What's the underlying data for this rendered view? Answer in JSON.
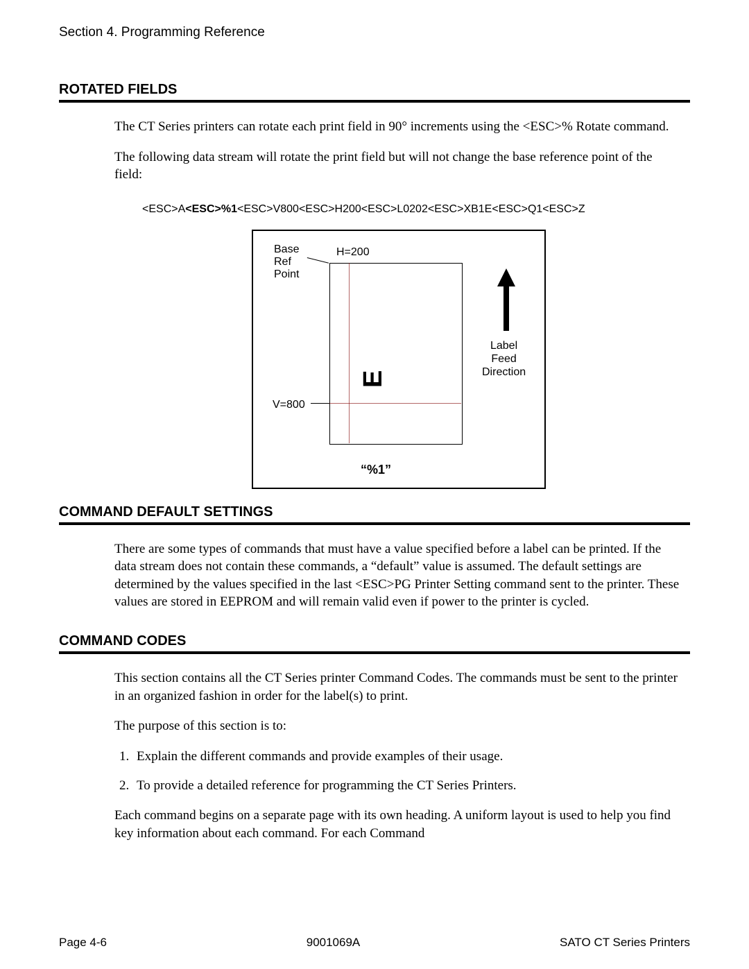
{
  "header": {
    "section": "Section 4. Programming Reference"
  },
  "sections": {
    "rotated_fields": {
      "title": "ROTATED FIELDS",
      "p1": "The CT Series printers can rotate each print field in 90° increments using the <ESC>% Rotate command.",
      "p2": "The following data stream will rotate the print field but will not change the base reference point of the field:",
      "code": {
        "pre": "<ESC>A",
        "bold": "<ESC>%1",
        "post": "<ESC>V800<ESC>H200<ESC>L0202<ESC>XB1E<ESC>Q1<ESC>Z"
      }
    },
    "command_default": {
      "title": "COMMAND DEFAULT SETTINGS",
      "p1": "There are some types of commands that must have a value specified before a label can be printed. If the data stream does not contain these commands, a “default” value is assumed. The default settings are determined by the values specified in the last <ESC>PG Printer Setting command sent to the printer. These values are stored in EEPROM and will remain valid even if power to the printer is cycled."
    },
    "command_codes": {
      "title": "COMMAND CODES",
      "p1": "This section contains all the CT Series printer Command Codes. The commands must be sent to the printer in an organized fashion in order for the label(s) to print.",
      "p2": "The purpose of this section is to:",
      "list": [
        "Explain the different commands and provide examples of their usage.",
        "To provide a detailed reference for programming the CT Series Printers."
      ],
      "p3": "Each command begins on a separate page with its own heading. A uniform layout is used to help you find key information about each command. For each Command"
    }
  },
  "figure": {
    "base_ref_l1": "Base",
    "base_ref_l2": "Ref",
    "base_ref_l3": "Point",
    "h_label": "H=200",
    "v_label": "V=800",
    "rotated_char": "E",
    "rotation_tag": "%1",
    "feed_l1": "Label",
    "feed_l2": "Feed",
    "feed_l3": "Direction"
  },
  "footer": {
    "left": "Page 4-6",
    "center": "9001069A",
    "right": "SATO CT Series Printers"
  }
}
